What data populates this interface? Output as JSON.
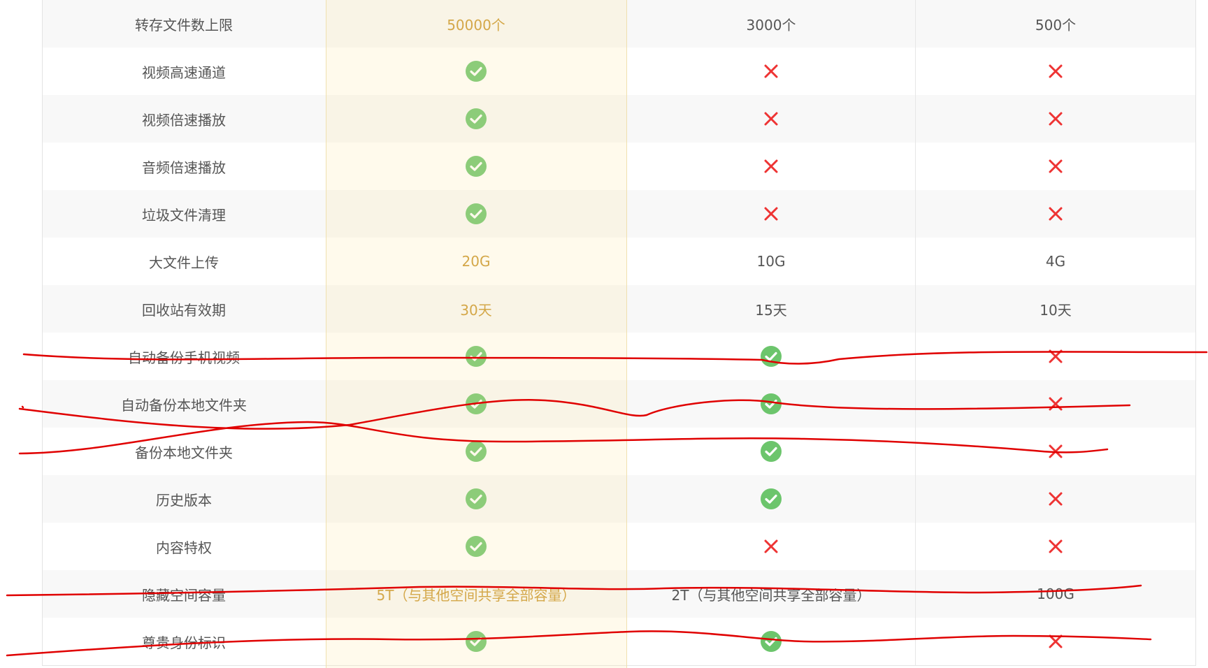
{
  "colors": {
    "check": "#6cc56c",
    "cross": "#ee3333",
    "gold": "#c8952e",
    "annotation": "#e00000"
  },
  "icons": {
    "check": "check-circle-icon",
    "cross": "cross-icon"
  },
  "rows": [
    {
      "feature": "转存文件数上限",
      "c1": "50000个",
      "c2": "3000个",
      "c3": "500个"
    },
    {
      "feature": "视频高速通道",
      "c1": "check",
      "c2": "cross",
      "c3": "cross"
    },
    {
      "feature": "视频倍速播放",
      "c1": "check",
      "c2": "cross",
      "c3": "cross"
    },
    {
      "feature": "音频倍速播放",
      "c1": "check",
      "c2": "cross",
      "c3": "cross"
    },
    {
      "feature": "垃圾文件清理",
      "c1": "check",
      "c2": "cross",
      "c3": "cross"
    },
    {
      "feature": "大文件上传",
      "c1": "20G",
      "c2": "10G",
      "c3": "4G"
    },
    {
      "feature": "回收站有效期",
      "c1": "30天",
      "c2": "15天",
      "c3": "10天"
    },
    {
      "feature": "自动备份手机视频",
      "c1": "check",
      "c2": "check",
      "c3": "cross"
    },
    {
      "feature": "自动备份本地文件夹",
      "c1": "check",
      "c2": "check",
      "c3": "cross"
    },
    {
      "feature": "备份本地文件夹",
      "c1": "check",
      "c2": "check",
      "c3": "cross"
    },
    {
      "feature": "历史版本",
      "c1": "check",
      "c2": "check",
      "c3": "cross"
    },
    {
      "feature": "内容特权",
      "c1": "check",
      "c2": "cross",
      "c3": "cross"
    },
    {
      "feature": "隐藏空间容量",
      "c1": "5T（与其他空间共享全部容量）",
      "c2": "2T（与其他空间共享全部容量）",
      "c3": "100G"
    },
    {
      "feature": "尊贵身份标识",
      "c1": "check",
      "c2": "check",
      "c3": "cross"
    }
  ]
}
